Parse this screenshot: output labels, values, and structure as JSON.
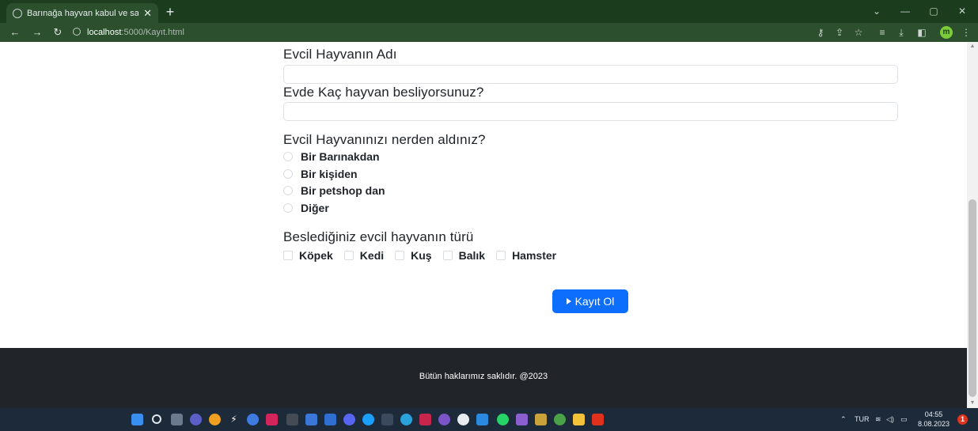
{
  "browser": {
    "tab_title": "Barınağa hayvan kabul ve sahiplen",
    "tab_close": "✕",
    "new_tab": "+",
    "url_host": "localhost",
    "url_path": ":5000/Kayıt.html",
    "profile_initial": "m"
  },
  "form": {
    "pet_name_label": "Evcil Hayvanın Adı",
    "pet_name_value": "",
    "pet_count_label": "Evde Kaç hayvan besliyorsunuz?",
    "pet_count_value": "",
    "source_label": "Evcil Hayvanınızı nerden aldınız?",
    "source_options": [
      "Bir Barınakdan",
      "Bir kişiden",
      "Bir petshop dan",
      "Diğer"
    ],
    "type_label": "Beslediğiniz evcil hayvanın türü",
    "type_options": [
      "Köpek",
      "Kedi",
      "Kuş",
      "Balık",
      "Hamster"
    ],
    "submit_label": "Kayıt Ol"
  },
  "footer": {
    "copyright": "Bütün haklarımız saklıdır. @2023"
  },
  "taskbar": {
    "language": "TUR",
    "time": "04:55",
    "date": "8.08.2023",
    "notification_count": "1"
  },
  "colors": {
    "accent": "#0d6efd",
    "footer_bg": "#212529",
    "browser_frame": "#1b3d1e"
  }
}
